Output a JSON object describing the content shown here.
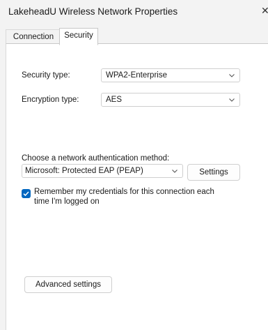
{
  "window": {
    "title": "LakeheadU Wireless Network Properties",
    "close_glyph": "✕"
  },
  "tabs": [
    {
      "label": "Connection",
      "selected": false
    },
    {
      "label": "Security",
      "selected": true
    }
  ],
  "security": {
    "security_type_label": "Security type:",
    "security_type_value": "WPA2-Enterprise",
    "encryption_type_label": "Encryption type:",
    "encryption_type_value": "AES",
    "auth_method_label": "Choose a network authentication method:",
    "auth_method_value": "Microsoft: Protected EAP (PEAP)",
    "settings_button": "Settings",
    "remember_credentials_line1": "Remember my credentials for this connection each",
    "remember_credentials_line2": "time I'm logged on",
    "remember_credentials_checked": true,
    "advanced_settings_button": "Advanced settings"
  },
  "colors": {
    "accent": "#0067c0",
    "background": "#f3f3f3",
    "panel": "#ffffff"
  }
}
